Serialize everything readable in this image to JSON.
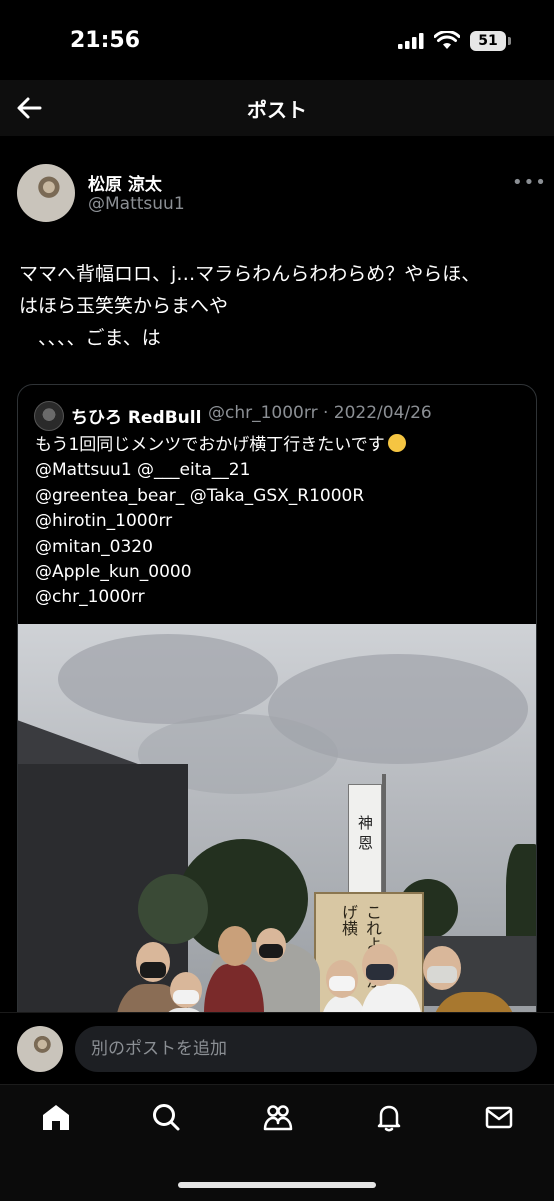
{
  "status_bar": {
    "time": "21:56",
    "battery": "51"
  },
  "header": {
    "title": "ポスト"
  },
  "post": {
    "author_name": "松原 涼太",
    "author_handle": "@Mattsuu1",
    "more": "•••",
    "text_lines": [
      "ママへ背幅ロロ、j…マラらわんらわわらめ？やらほ、",
      "はほら玉笑笑からまへや",
      "　、、、、ごま、は"
    ]
  },
  "quoted": {
    "author_name": "ちひろ RedBull",
    "author_handle_date": "@chr_1000rr · 2022/04/26",
    "lines": [
      "もう1回同じメンツでおかげ横丁行きたいです",
      "@Mattsuu1 @___eita__21",
      "@greentea_bear_ @Taka_GSX_R1000R",
      "@hirotin_1000rr",
      "@mitan_0320",
      "@Apple_kun_0000",
      "@chr_1000rr"
    ],
    "photo_sign_text": "これよ おかげ横",
    "photo_banner_text": "神 恩"
  },
  "composer": {
    "placeholder": "別のポストを追加"
  },
  "tabs": [
    {
      "icon": "home-icon"
    },
    {
      "icon": "search-icon"
    },
    {
      "icon": "communities-icon"
    },
    {
      "icon": "bell-icon"
    },
    {
      "icon": "mail-icon"
    }
  ],
  "colors": {
    "background": "#000000",
    "muted": "#8b8f94",
    "border": "#2f3336"
  }
}
